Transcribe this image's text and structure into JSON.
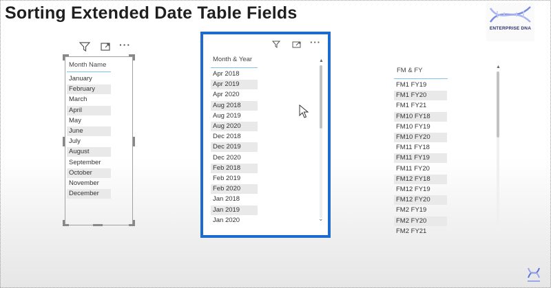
{
  "title": "Sorting Extended Date Table Fields",
  "logo": {
    "text": "ENTERPRISE DNA",
    "icon": "dna-helix-icon",
    "accent": "#5b6fd6"
  },
  "slicer1": {
    "header": "Month Name",
    "items": [
      "January",
      "February",
      "March",
      "April",
      "May",
      "June",
      "July",
      "August",
      "September",
      "October",
      "November",
      "December"
    ]
  },
  "slicer2": {
    "header": "Month & Year",
    "items": [
      "Apr 2018",
      "Apr 2019",
      "Apr 2020",
      "Aug 2018",
      "Aug 2019",
      "Aug 2020",
      "Dec 2018",
      "Dec 2019",
      "Dec 2020",
      "Feb 2018",
      "Feb 2019",
      "Feb 2020",
      "Jan 2018",
      "Jan 2019",
      "Jan 2020"
    ],
    "selected_border_color": "#1e6bd0"
  },
  "slicer3": {
    "header": "FM & FY",
    "items": [
      "FM1 FY19",
      "FM1 FY20",
      "FM1 FY21",
      "FM10 FY18",
      "FM10 FY19",
      "FM10 FY20",
      "FM11 FY18",
      "FM11 FY19",
      "FM11 FY20",
      "FM12 FY18",
      "FM12 FY19",
      "FM12 FY20",
      "FM2 FY19",
      "FM2 FY20",
      "FM2 FY21"
    ]
  },
  "toolbar": {
    "filter_icon": "filter-icon",
    "focus_icon": "focus-mode-icon",
    "more_icon": "more-options-icon",
    "more_label": "···"
  },
  "scroll": {
    "up": "▲",
    "down": "⌄"
  }
}
